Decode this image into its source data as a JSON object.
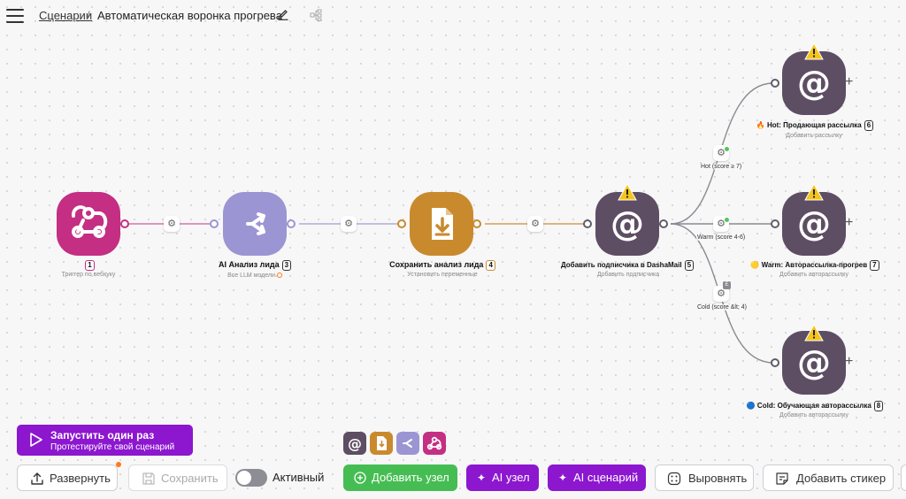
{
  "header": {
    "breadcrumb_link": "Сценарии",
    "separator": "/",
    "title": "Автоматическая воронка прогрева"
  },
  "nodes": [
    {
      "id": "1",
      "label": "",
      "subtitle": "Триггер по вебхуку",
      "number": "1",
      "color": "#c42e83",
      "icon": "webhook-icon"
    },
    {
      "id": "3",
      "label": "AI Анализ лида",
      "subtitle": "Все LLM модели",
      "number": "3",
      "color": "#9b95d3",
      "icon": "branch-arrows-icon"
    },
    {
      "id": "4",
      "label": "Сохранить анализ лида",
      "subtitle": "Установить переменные",
      "number": "4",
      "color": "#c98a2e",
      "icon": "file-download-icon"
    },
    {
      "id": "5",
      "label": "Добавить подписчика в DashaMail",
      "subtitle": "Добавить подписчика",
      "number": "5",
      "color": "#5d4e63",
      "icon": "at-sign-icon"
    },
    {
      "id": "6",
      "label": "🔥 Hot: Продающая рассылка",
      "subtitle": "Добавить рассылку",
      "number": "6",
      "color": "#5d4e63",
      "icon": "at-sign-icon"
    },
    {
      "id": "7",
      "label": "🟡 Warm: Авторассылка-прогрев",
      "subtitle": "Добавить авторассылку",
      "number": "7",
      "color": "#5d4e63",
      "icon": "at-sign-icon"
    },
    {
      "id": "8",
      "label": "🔵 Cold: Обучающая авторассылка",
      "subtitle": "Добавить авторассылку",
      "number": "8",
      "color": "#5d4e63",
      "icon": "at-sign-icon"
    }
  ],
  "branches": {
    "hot": "Hot (score ≥ 7)",
    "warm": "Warm (score 4-6)",
    "cold": "Cold (score &lt; 4)",
    "cold_badge": "E"
  },
  "run_once": {
    "title": "Запустить один раз",
    "subtitle": "Протестируйте свой сценарий"
  },
  "palette": [
    {
      "name": "palette-at-sign",
      "color": "#5d4e63"
    },
    {
      "name": "palette-set-variables",
      "color": "#c98a2e"
    },
    {
      "name": "palette-ai-branch",
      "color": "#9b95d3"
    },
    {
      "name": "palette-webhook",
      "color": "#c42e83"
    }
  ],
  "toolbar": {
    "deploy": "Развернуть",
    "save": "Сохранить",
    "active": "Активный",
    "add_node": "Добавить узел",
    "ai_node": "AI узел",
    "ai_scenario": "AI сценарий",
    "align": "Выровнять",
    "add_sticker": "Добавить стикер"
  },
  "colors": {
    "accent_purple": "#8c17cf",
    "green": "#45bd52",
    "warning": "#f5c518",
    "notification": "#ff7a1a"
  }
}
